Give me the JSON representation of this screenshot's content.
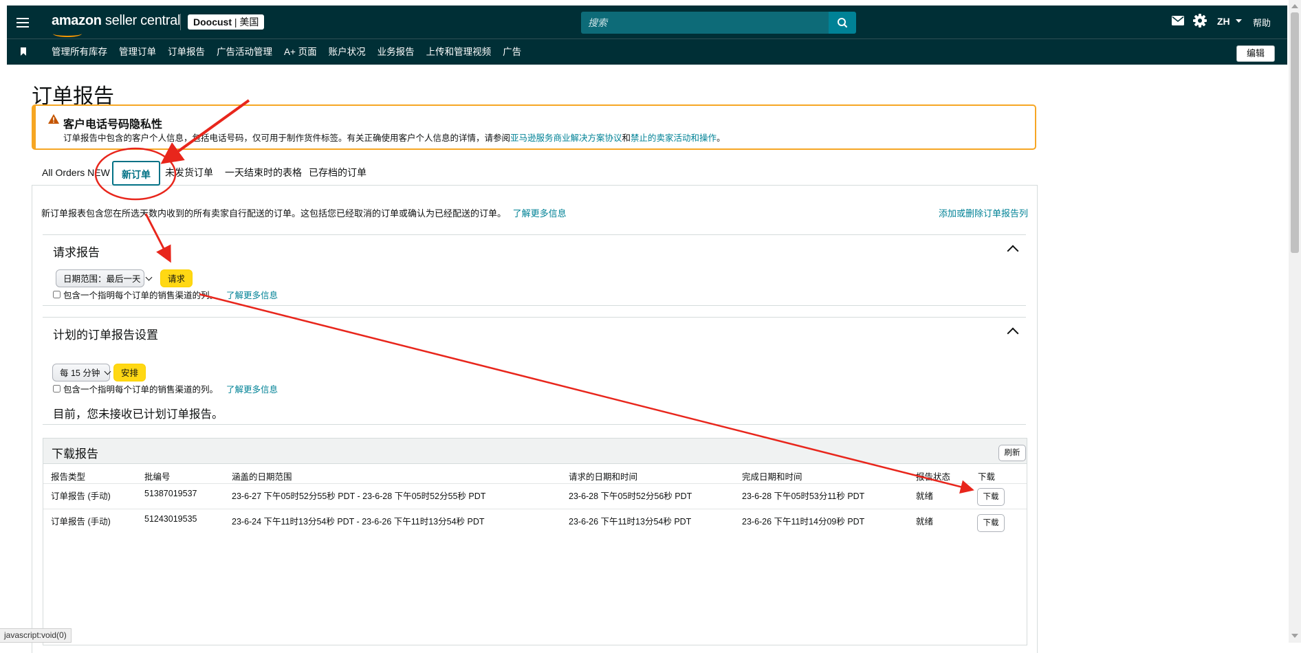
{
  "topbar": {
    "logo_main": "amazon",
    "logo_rest": " seller central",
    "store_name": "Doocust",
    "store_sep": " | ",
    "store_region": "美国",
    "search_placeholder": "搜索",
    "lang": "ZH",
    "help": "帮助"
  },
  "nav": {
    "items": [
      "管理所有库存",
      "管理订单",
      "订单报告",
      "广告活动管理",
      "A+ 页面",
      "账户状况",
      "业务报告",
      "上传和管理视频",
      "广告"
    ],
    "edit": "编辑"
  },
  "page": {
    "title": "订单报告"
  },
  "alert": {
    "title": "客户电话号码隐私性",
    "text_before": "订单报告中包含的客户个人信息，包括电话号码，仅可用于制作货件标签。有关正确使用客户个人信息的详情，请参阅",
    "link1": "亚马逊服务商业解决方案协议",
    "and": "和",
    "link2": "禁止的卖家活动和操作",
    "text_after": "。"
  },
  "tabs": [
    "All Orders NEW",
    "新订单",
    "未发货订单",
    "一天结束时的表格",
    "已存档的订单"
  ],
  "content": {
    "desc": "新订单报表包含您在所选天数内收到的所有卖家自行配送的订单。这包括您已经取消的订单或确认为已经配送的订单。",
    "learn_more": "了解更多信息",
    "add_remove_cols": "添加或删除订单报告列"
  },
  "request_section": {
    "title": "请求报告",
    "date_range": "日期范围：最后一天",
    "request_btn": "请求",
    "checkbox_label": "包含一个指明每个订单的销售渠道的列。",
    "learn_more": "了解更多信息"
  },
  "schedule_section": {
    "title": "计划的订单报告设置",
    "interval": "每 15 分钟",
    "schedule_btn": "安排",
    "checkbox_label": "包含一个指明每个订单的销售渠道的列。",
    "learn_more": "了解更多信息",
    "note": "目前，您未接收已计划订单报告。"
  },
  "download": {
    "title": "下载报告",
    "refresh": "刷新",
    "columns": [
      "报告类型",
      "批编号",
      "涵盖的日期范围",
      "请求的日期和时间",
      "完成日期和时间",
      "报告状态",
      "下载"
    ],
    "rows": [
      {
        "type": "订单报告 (手动)",
        "batch": "51387019537",
        "range": "23-6-27 下午05时52分55秒 PDT - 23-6-28 下午05时52分55秒 PDT",
        "requested": "23-6-28 下午05时52分56秒 PDT",
        "completed": "23-6-28 下午05时53分11秒 PDT",
        "status": "就绪",
        "action": "下载"
      },
      {
        "type": "订单报告 (手动)",
        "batch": "51243019535",
        "range": "23-6-24 下午11时13分54秒 PDT - 23-6-26 下午11时13分54秒 PDT",
        "requested": "23-6-26 下午11时13分54秒 PDT",
        "completed": "23-6-26 下午11时14分09秒 PDT",
        "status": "就绪",
        "action": "下载"
      }
    ]
  },
  "statusbar": "javascript:void(0)",
  "colors": {
    "topbar": "#002f36",
    "accent": "#008296",
    "alert_border": "#f6a623",
    "button_yellow": "#ffd814",
    "annotation_red": "#e8261c"
  }
}
